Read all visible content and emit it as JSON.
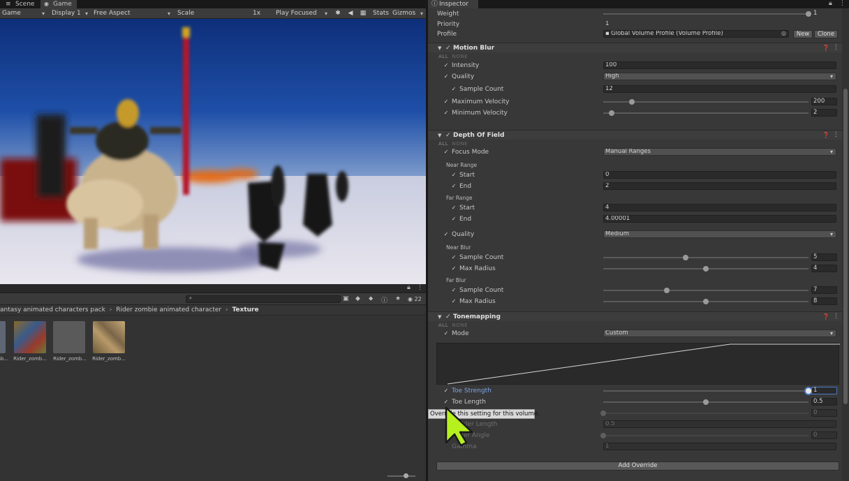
{
  "tabs": {
    "scene": "Scene",
    "game": "Game"
  },
  "game_toolbar": {
    "view": "Game",
    "display": "Display 1",
    "aspect": "Free Aspect",
    "scale_label": "Scale",
    "scale_value": "1x",
    "play_mode": "Play Focused",
    "stats": "Stats",
    "gizmos": "Gizmos"
  },
  "project": {
    "count": "22",
    "breadcrumb": [
      "antasy animated characters pack",
      "Rider zombie animated character",
      "Texture"
    ],
    "assets": [
      {
        "label": "mb..."
      },
      {
        "label": "Rider_zomb..."
      },
      {
        "label": "Rider_zomb..."
      },
      {
        "label": "Rider_zomb..."
      }
    ]
  },
  "inspector": {
    "tab": "Inspector",
    "weight": {
      "label": "Weight",
      "value": "1",
      "fraction": 1.0
    },
    "priority": {
      "label": "Priority",
      "value": "1"
    },
    "profile": {
      "label": "Profile",
      "value": "Global Volume Profile (Volume Profile)",
      "new": "New",
      "clone": "Clone"
    },
    "all": "ALL",
    "none": "NONE",
    "motion_blur": {
      "title": "Motion Blur",
      "intensity": {
        "label": "Intensity",
        "value": "100"
      },
      "quality": {
        "label": "Quality",
        "value": "High"
      },
      "sample_count": {
        "label": "Sample Count",
        "value": "12"
      },
      "max_velocity": {
        "label": "Maximum Velocity",
        "value": "200",
        "fraction": 0.14
      },
      "min_velocity": {
        "label": "Minimum Velocity",
        "value": "2",
        "fraction": 0.04
      }
    },
    "dof": {
      "title": "Depth Of Field",
      "focus_mode": {
        "label": "Focus Mode",
        "value": "Manual Ranges"
      },
      "near_range": "Near Range",
      "near_start": {
        "label": "Start",
        "value": "0"
      },
      "near_end": {
        "label": "End",
        "value": "2"
      },
      "far_range": "Far Range",
      "far_start": {
        "label": "Start",
        "value": "4"
      },
      "far_end": {
        "label": "End",
        "value": "4.00001"
      },
      "quality": {
        "label": "Quality",
        "value": "Medium"
      },
      "near_blur": "Near Blur",
      "near_sample": {
        "label": "Sample Count",
        "value": "5",
        "fraction": 0.4
      },
      "near_radius": {
        "label": "Max Radius",
        "value": "4",
        "fraction": 0.5
      },
      "far_blur": "Far Blur",
      "far_sample": {
        "label": "Sample Count",
        "value": "7",
        "fraction": 0.31
      },
      "far_radius": {
        "label": "Max Radius",
        "value": "8",
        "fraction": 0.5
      }
    },
    "tonemapping": {
      "title": "Tonemapping",
      "mode": {
        "label": "Mode",
        "value": "Custom"
      },
      "toe_strength": {
        "label": "Toe Strength",
        "value": "1",
        "fraction": 1.0
      },
      "toe_length": {
        "label": "Toe Length",
        "value": "0.5",
        "fraction": 0.5
      },
      "shoulder_strength": {
        "value": "0",
        "fraction": 0.0
      },
      "shoulder_length": {
        "label": "...ulder Length",
        "value": "0.5"
      },
      "shoulder_angle": {
        "label": "...lder Angle",
        "value": "0",
        "fraction": 0.0
      },
      "gamma": {
        "label": "Gamma",
        "value": "1"
      }
    },
    "add_override": "Add Override",
    "tooltip": "Override this setting for this volume."
  }
}
